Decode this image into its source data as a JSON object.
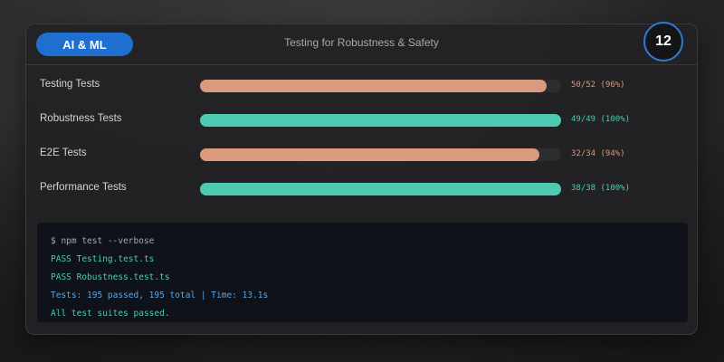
{
  "header": {
    "category_label": "AI & ML",
    "title": "Testing for Robustness & Safety",
    "number_badge": "12"
  },
  "colors": {
    "accent_blue": "#1f6fd1",
    "bar_warning": "#d99a7e",
    "bar_success": "#4fcab2",
    "terminal_green": "#4fcab2",
    "terminal_blue": "#5aa6e6",
    "terminal_gray": "#a8a8ad"
  },
  "test_rows": [
    {
      "label": "Testing Tests",
      "value_text": "50/52 (96%)",
      "progress": 0.96,
      "status": "warning"
    },
    {
      "label": "Robustness Tests",
      "value_text": "49/49 (100%)",
      "progress": 1.0,
      "status": "success"
    },
    {
      "label": "E2E Tests",
      "value_text": "32/34 (94%)",
      "progress": 0.94,
      "status": "warning"
    },
    {
      "label": "Performance Tests",
      "value_text": "38/38 (100%)",
      "progress": 1.0,
      "status": "success"
    }
  ],
  "terminal": {
    "lines": [
      {
        "text": "$ npm test --verbose",
        "kind": "command"
      },
      {
        "text": "PASS Testing.test.ts",
        "kind": "pass"
      },
      {
        "text": "PASS Robustness.test.ts",
        "kind": "pass"
      },
      {
        "text": "Tests: 195 passed, 195 total | Time: 13.1s",
        "kind": "summary"
      },
      {
        "text": "All test suites passed.",
        "kind": "pass"
      }
    ]
  }
}
